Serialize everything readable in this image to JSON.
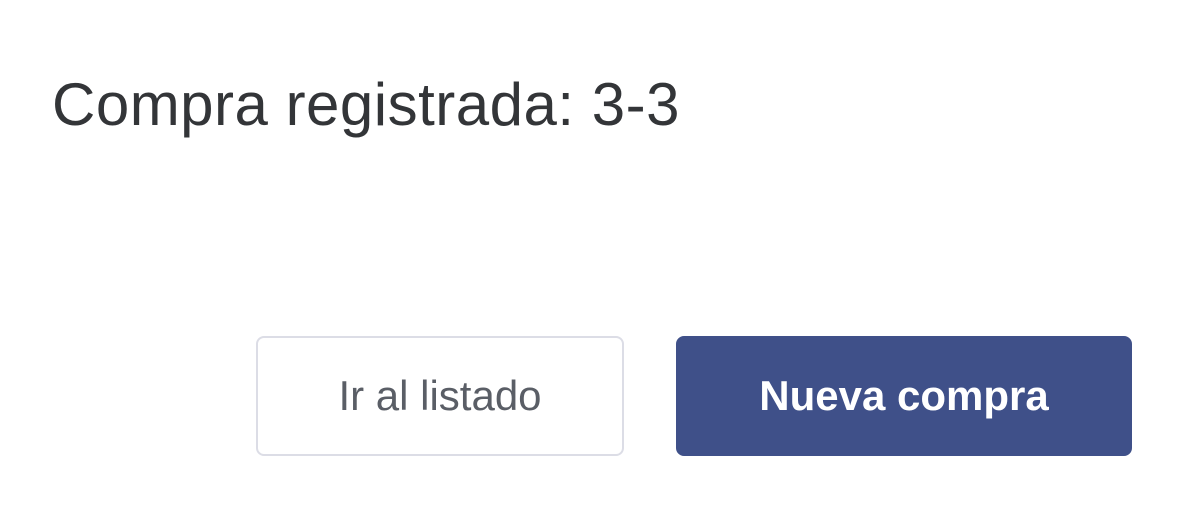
{
  "dialog": {
    "title": "Compra registrada: 3-3",
    "buttons": {
      "list_label": "Ir al listado",
      "new_label": "Nueva compra"
    }
  },
  "colors": {
    "title_text": "#333538",
    "primary_button_bg": "#3f5089",
    "primary_button_text": "#ffffff",
    "secondary_button_border": "#dcdde6",
    "secondary_button_text": "#5a5e66"
  }
}
